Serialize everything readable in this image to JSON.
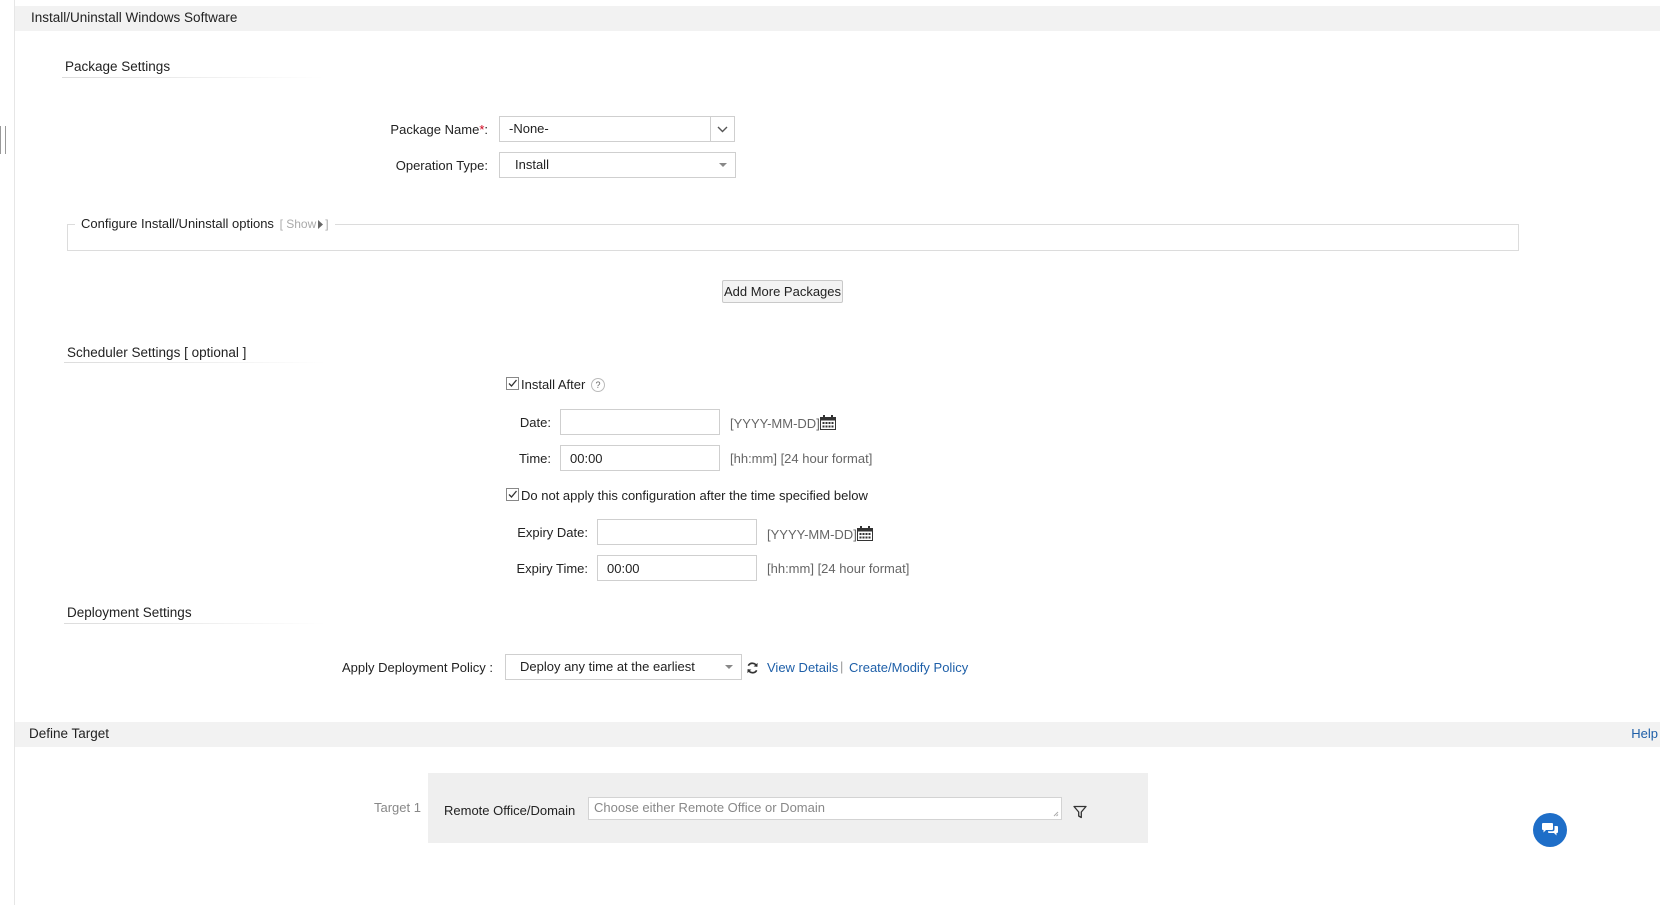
{
  "page_title": "Install/Uninstall Windows Software",
  "package_settings": {
    "heading": "Package Settings",
    "package_name_label": "Package Name",
    "required_mark": "*",
    "colon": ":",
    "package_name_value": "-None-",
    "operation_type_label": "Operation Type:",
    "operation_type_value": "Install",
    "configure_label": "Configure Install/Uninstall options",
    "show_toggle_open": "[ Show",
    "show_toggle_close": "]",
    "add_more_button": "Add More Packages"
  },
  "scheduler": {
    "heading": "Scheduler Settings [ optional ]",
    "install_after_label": "Install After",
    "help_glyph": "?",
    "date_label": "Date:",
    "date_value": "",
    "date_hint": "[YYYY-MM-DD]",
    "time_label": "Time:",
    "time_value": "00:00",
    "time_hint": "[hh:mm] [24 hour format]",
    "expiry_checkbox_label": "Do not apply this configuration after the time specified below",
    "expiry_date_label": "Expiry Date:",
    "expiry_date_value": "",
    "expiry_date_hint": "[YYYY-MM-DD]",
    "expiry_time_label": "Expiry Time:",
    "expiry_time_value": "00:00",
    "expiry_time_hint": "[hh:mm] [24 hour format]",
    "install_after_checked": true,
    "expiry_checked": true
  },
  "deployment": {
    "heading": "Deployment Settings",
    "policy_label": "Apply Deployment Policy :",
    "policy_value": "Deploy any time at the earliest",
    "view_details": "View Details",
    "separator": "|",
    "create_modify": "Create/Modify Policy"
  },
  "target": {
    "heading": "Define Target",
    "help": "Help",
    "target_label": "Target 1",
    "remote_label": "Remote Office/Domain",
    "remote_placeholder": "Choose either Remote Office or Domain"
  },
  "colors": {
    "link": "#1e5fa8",
    "title_bg": "#f2f2f2",
    "chat_button": "#1e6ec8"
  },
  "icons": [
    "chevron-down-icon",
    "caret-down-icon",
    "calendar-icon",
    "refresh-icon",
    "filter-icon",
    "chat-icon",
    "checkmark-icon",
    "help-icon"
  ]
}
